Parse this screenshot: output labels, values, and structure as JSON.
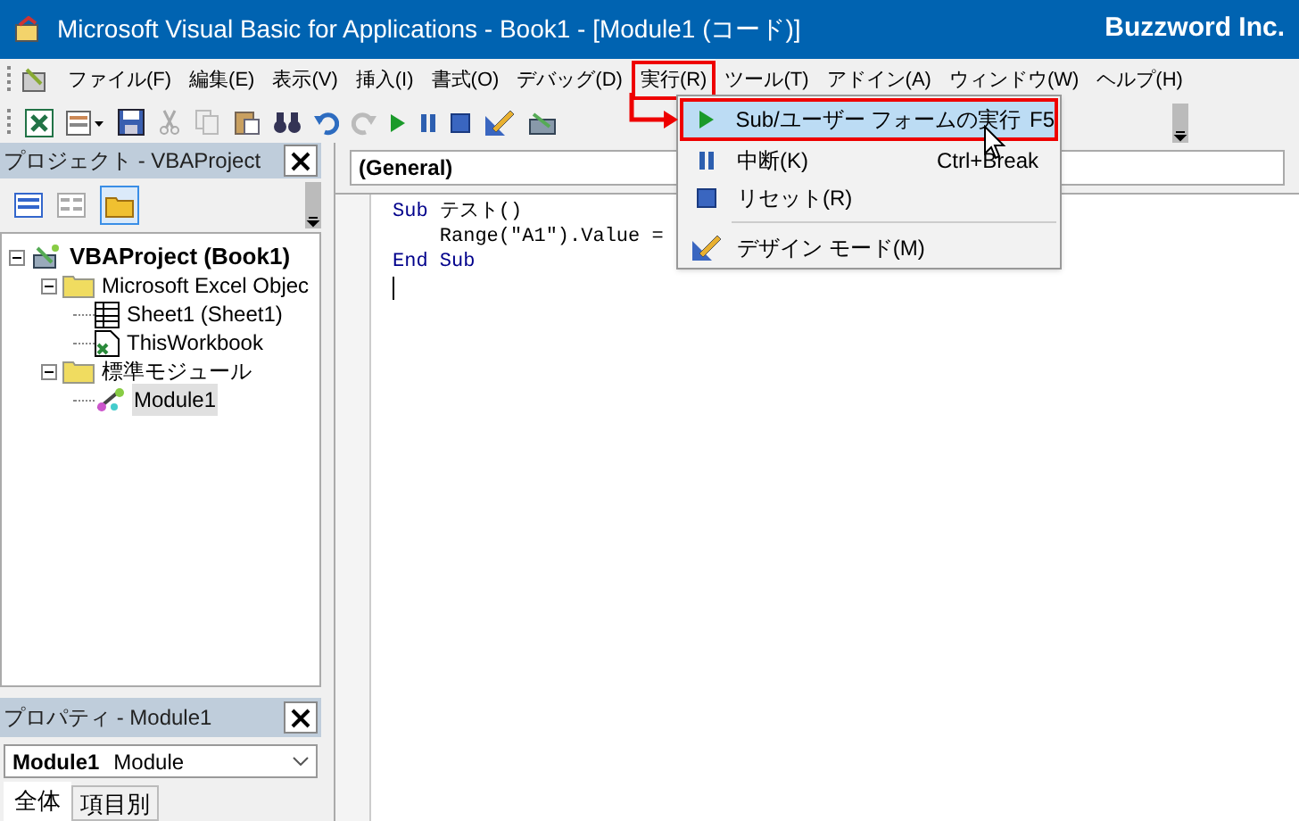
{
  "window": {
    "title": "Microsoft Visual Basic for Applications - Book1 - [Module1 (コード)]",
    "brand": "Buzzword Inc."
  },
  "menu_bar": [
    {
      "label": "ファイル(F)",
      "selected": false
    },
    {
      "label": "編集(E)",
      "selected": false
    },
    {
      "label": "表示(V)",
      "selected": false
    },
    {
      "label": "挿入(I)",
      "selected": false
    },
    {
      "label": "書式(O)",
      "selected": false
    },
    {
      "label": "デバッグ(D)",
      "selected": false
    },
    {
      "label": "実行(R)",
      "selected": true
    },
    {
      "label": "ツール(T)",
      "selected": false
    },
    {
      "label": "アドイン(A)",
      "selected": false
    },
    {
      "label": "ウィンドウ(W)",
      "selected": false
    },
    {
      "label": "ヘルプ(H)",
      "selected": false
    }
  ],
  "run_menu": {
    "items": [
      {
        "label": "Sub/ユーザー フォームの実行",
        "shortcut": "F5",
        "selected": true,
        "separator_before": false
      },
      {
        "label": "中断(K)",
        "shortcut": "Ctrl+Break",
        "selected": false,
        "separator_before": false
      },
      {
        "label": "リセット(R)",
        "selected": false,
        "separator_before": false
      },
      {
        "label": "デザイン モード(M)",
        "selected": false,
        "separator_before": true
      }
    ]
  },
  "project_panel": {
    "title": "プロジェクト - VBAProject",
    "tree": [
      {
        "label": "VBAProject (Book1)",
        "kind": "project",
        "selected": false,
        "children": [
          {
            "label": "Microsoft Excel Objec",
            "kind": "folder",
            "selected": false,
            "children": [
              {
                "label": "Sheet1 (Sheet1)",
                "kind": "sheet",
                "selected": false
              },
              {
                "label": "ThisWorkbook",
                "kind": "workbook",
                "selected": false
              }
            ]
          },
          {
            "label": "標準モジュール",
            "kind": "folder",
            "selected": false,
            "children": [
              {
                "label": "Module1",
                "kind": "module",
                "selected": true
              }
            ]
          }
        ]
      }
    ]
  },
  "properties_panel": {
    "title": "プロパティ - Module1",
    "object_name": "Module1",
    "object_type": "Module",
    "tabs": [
      {
        "label": "全体",
        "selected": true
      },
      {
        "label": "項目別",
        "selected": false
      }
    ]
  },
  "code_window": {
    "object_dropdown": "(General)",
    "lines": [
      [
        {
          "text": "Sub",
          "kind": "keyword"
        },
        {
          "text": " テスト()",
          "kind": "plain"
        }
      ],
      [
        {
          "text": "    Range(\"A1\").Value =",
          "kind": "plain"
        }
      ],
      [
        {
          "text": "End Sub",
          "kind": "keyword"
        }
      ]
    ]
  }
}
